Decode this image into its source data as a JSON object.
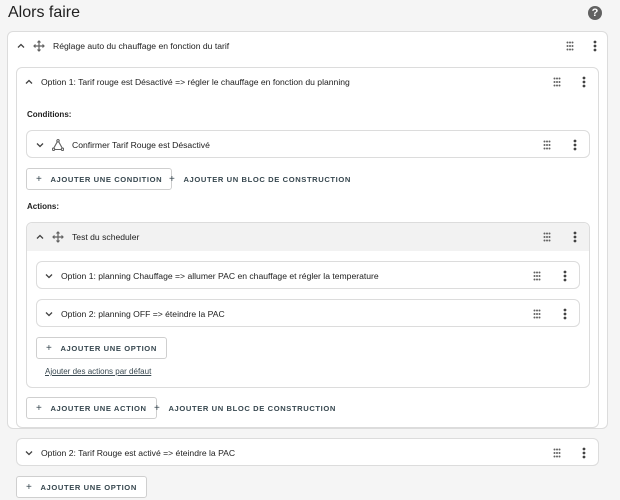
{
  "header": {
    "title": "Alors faire",
    "help_glyph": "?"
  },
  "automation": {
    "title": "Réglage auto du chauffage en fonction du tarif",
    "option1": {
      "title": "Option 1: Tarif rouge est Désactivé => régler le chauffage en fonction du planning",
      "conditions_label": "Conditions:",
      "condition_item": "Confirmer Tarif Rouge est Désactivé",
      "add_condition": "AJOUTER UNE CONDITION",
      "add_block": "AJOUTER UN BLOC DE CONSTRUCTION",
      "actions_label": "Actions:",
      "scheduler": {
        "title": "Test du scheduler",
        "option_a": "Option 1: planning Chauffage => allumer PAC en chauffage et régler la temperature",
        "option_b": "Option 2: planning OFF => éteindre la PAC",
        "add_option": "AJOUTER UNE OPTION",
        "default_actions": "Ajouter des actions par défaut"
      },
      "add_action": "AJOUTER UNE ACTION",
      "add_block2": "AJOUTER UN BLOC DE CONSTRUCTION"
    },
    "option2": {
      "title": "Option 2: Tarif Rouge est activé => éteindre la PAC"
    },
    "add_option": "AJOUTER UNE OPTION"
  },
  "icons": {
    "chevron_up": "chevron-up-icon",
    "chevron_down": "chevron-down-icon",
    "move": "arrows-move-icon",
    "triangle": "condition-triangle-icon",
    "grip": "drag-grip-icon",
    "kebab": "more-vert-icon"
  },
  "colors": {
    "background": "#f5f5f5",
    "card": "#ffffff",
    "border": "#dcdcdc",
    "highlight": "#f2f2f2",
    "text": "#212121"
  }
}
